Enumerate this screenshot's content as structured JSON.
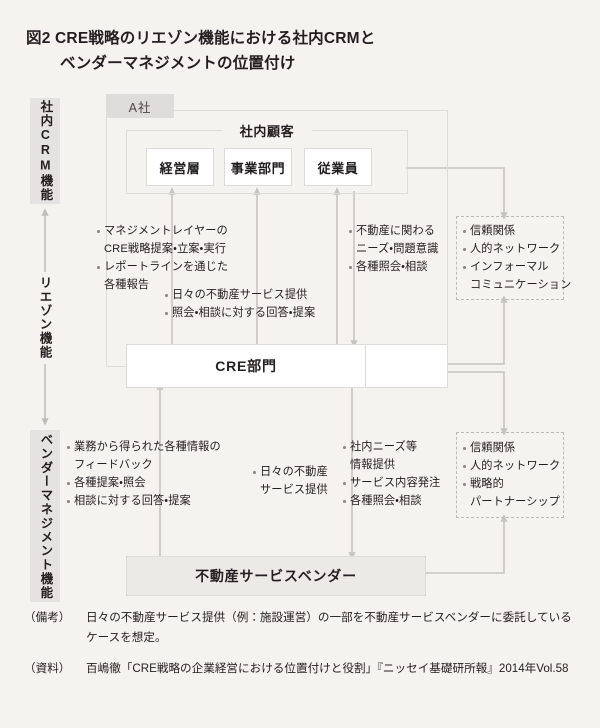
{
  "figure": {
    "title_line1": "図2 CRE戦略のリエゾン機能における社内CRMと",
    "title_line2": "ベンダーマネジメントの位置付け"
  },
  "rail": {
    "top_label": "社内CRM機能",
    "middle_label": "リエゾン機能",
    "bottom_label": "ベンダーマネジメント機能"
  },
  "company": {
    "tab_label": "A社",
    "customer_group_label": "社内顧客",
    "customer_nodes": [
      {
        "label": "経営層"
      },
      {
        "label": "事業部門"
      },
      {
        "label": "従業員"
      }
    ]
  },
  "cre_department": {
    "label": "CRE部門"
  },
  "vendor": {
    "label": "不動産サービスベンダー"
  },
  "annotations": {
    "mgmt_layer": [
      "マネジメントレイヤーの",
      "CRE戦略提案・立案・実行",
      "レポートラインを通じた",
      "各種報告"
    ],
    "daily_service_upper": [
      "日々の不動産サービス提供",
      "照会・相談に対する回答・提案"
    ],
    "needs_upper": [
      "不動産に関わる",
      "ニーズ・問題意識",
      "各種照会・相談"
    ],
    "feedback_lower": [
      "業務から得られた各種情報の",
      "フィードバック",
      "各種提案・照会",
      "相談に対する回答・提案"
    ],
    "daily_service_lower": [
      "日々の不動産",
      "サービス提供"
    ],
    "needs_lower": [
      "社内ニーズ等",
      "情報提供",
      "サービス内容発注",
      "各種照会・相談"
    ]
  },
  "outcome_boxes": {
    "upper": [
      "信頼関係",
      "人的ネットワーク",
      "インフォーマル",
      "コミュニケーション"
    ],
    "lower": [
      "信頼関係",
      "人的ネットワーク",
      "戦略的",
      "パートナーシップ"
    ]
  },
  "footnotes": {
    "note_label": "（備考）",
    "note_text": "日々の不動産サービス提供（例：施設運営）の一部を不動産サービスベンダーに委託しているケースを想定。",
    "source_label": "（資料）",
    "source_text": "百嶋徹「CRE戦略の企業経営における位置付けと役割」『ニッセイ基礎研所報』2014年Vol.58"
  },
  "colors": {
    "background": "#f4f3f0",
    "chip": "#e4e3e1",
    "line": "#c9c7c3",
    "box_border": "#dcdbd8",
    "dash_border": "#bdbbb7",
    "vendor_fill": "#eceae7",
    "text": "#231f20"
  }
}
